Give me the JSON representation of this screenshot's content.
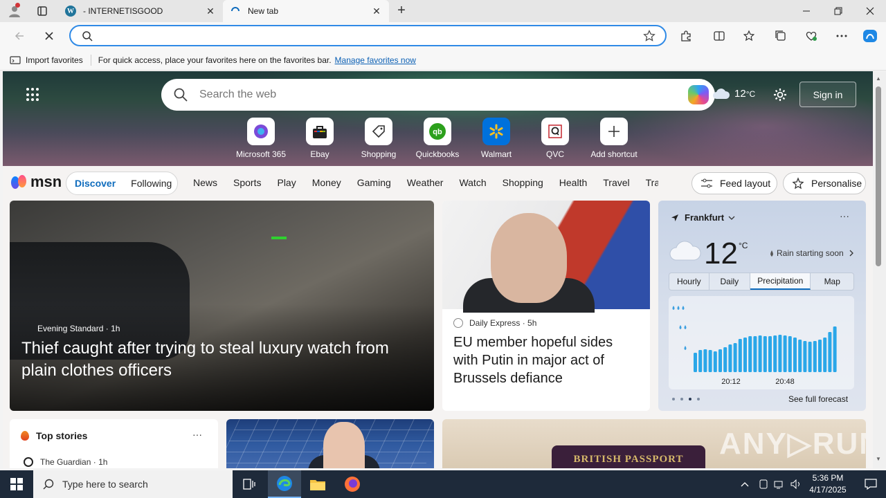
{
  "browser": {
    "tabs": [
      {
        "title": "- INTERNETISGOOD",
        "active": false
      },
      {
        "title": "New tab",
        "active": true
      }
    ],
    "address": {
      "value": "",
      "placeholder": ""
    },
    "favorites_bar": {
      "import_label": "Import favorites",
      "hint": "For quick access, place your favorites here on the favorites bar.",
      "manage_link": "Manage favorites now"
    }
  },
  "newtab": {
    "search_placeholder": "Search the web",
    "weather_temp": "12",
    "weather_unit": "°C",
    "signin_label": "Sign in",
    "shortcuts": [
      {
        "label": "Microsoft 365",
        "icon": "microsoft-365-icon"
      },
      {
        "label": "Ebay",
        "icon": "ebay-icon"
      },
      {
        "label": "Shopping",
        "icon": "shopping-tag-icon"
      },
      {
        "label": "Quickbooks",
        "icon": "quickbooks-icon"
      },
      {
        "label": "Walmart",
        "icon": "walmart-icon"
      },
      {
        "label": "QVC",
        "icon": "qvc-icon"
      },
      {
        "label": "Add shortcut",
        "icon": "plus-icon"
      }
    ]
  },
  "feed": {
    "logo": "msn",
    "pills": {
      "discover": "Discover",
      "following": "Following"
    },
    "nav": [
      "News",
      "Sports",
      "Play",
      "Money",
      "Gaming",
      "Weather",
      "Watch",
      "Shopping",
      "Health",
      "Travel",
      "Tra"
    ],
    "feed_layout_label": "Feed layout",
    "personalise_label": "Personalise"
  },
  "cards": {
    "main": {
      "source": "Evening Standard",
      "age": "1h",
      "headline": "Thief caught after trying to steal luxury watch from plain clothes officers"
    },
    "putin": {
      "source": "Daily Express",
      "age": "5h",
      "headline": "EU member hopeful sides with Putin in major act of Brussels defiance"
    },
    "weather": {
      "location": "Frankfurt",
      "temp": "12",
      "unit": "°C",
      "condition": "Rain starting soon",
      "tabs": [
        "Hourly",
        "Daily",
        "Precipitation",
        "Map"
      ],
      "active_tab": "Precipitation",
      "time_labels": [
        "20:12",
        "20:48"
      ],
      "bar_levels": [
        0.28,
        0.32,
        0.33,
        0.32,
        0.3,
        0.33,
        0.36,
        0.4,
        0.42,
        0.48,
        0.5,
        0.52,
        0.52,
        0.53,
        0.52,
        0.52,
        0.53,
        0.54,
        0.53,
        0.52,
        0.5,
        0.47,
        0.45,
        0.44,
        0.45,
        0.47,
        0.5,
        0.58,
        0.66
      ],
      "forecast_link": "See full forecast"
    },
    "top_stories": {
      "title": "Top stories",
      "source": "The Guardian",
      "age": "1h"
    },
    "passport": {
      "text": "BRITISH PASSPORT"
    }
  },
  "watermark": "ANY▷RUN",
  "taskbar": {
    "search_placeholder": "Type here to search",
    "time": "5:36 PM",
    "date": "4/17/2025"
  },
  "colors": {
    "accent": "#0f6cbd",
    "address_border": "#2f8ae6",
    "precip_bar": "#2aa7e8",
    "taskbar": "#1e2a3a"
  }
}
